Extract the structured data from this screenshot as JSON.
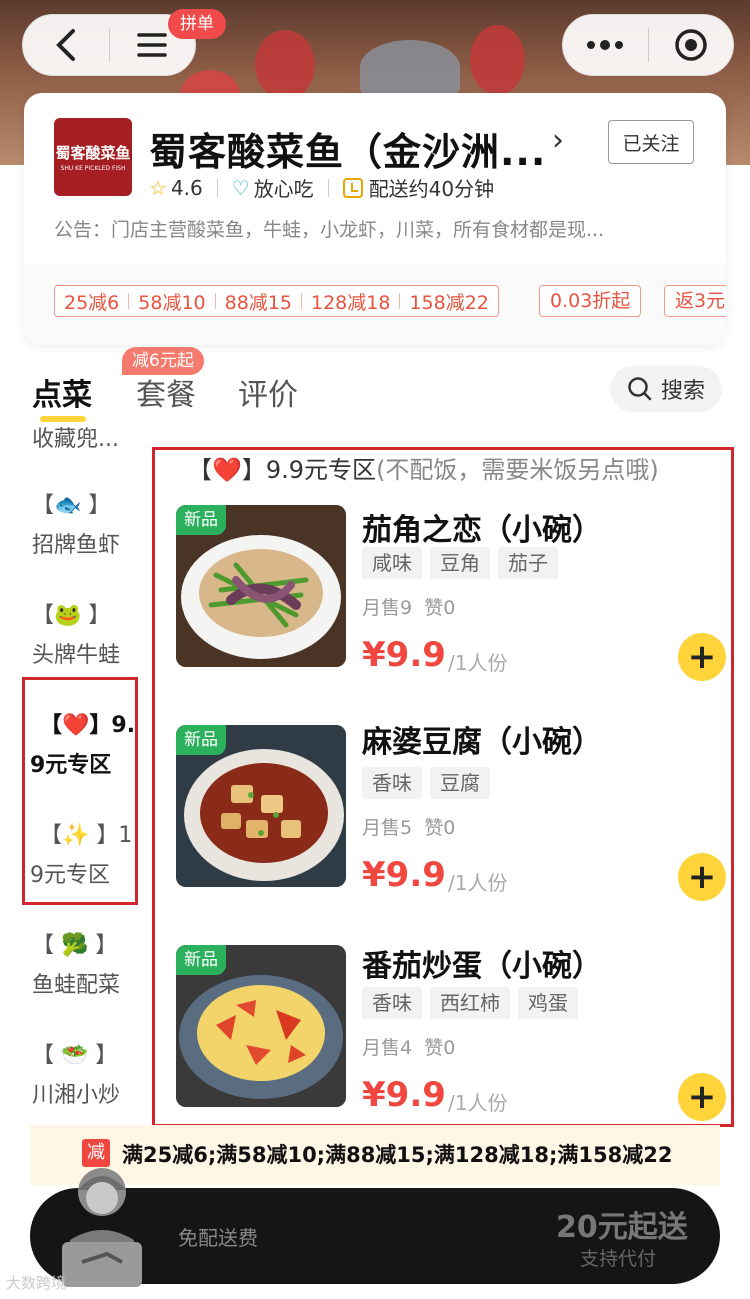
{
  "topbar": {
    "pindan_label": "拼单"
  },
  "shop": {
    "name": "蜀客酸菜鱼（金沙洲...",
    "logo_text": "蜀客酸菜鱼",
    "logo_sub": "SHU KE PICKLED FISH",
    "follow_label": "已关注",
    "rating": "4.6",
    "safe_label": "放心吃",
    "delivery_label": "配送约40分钟",
    "notice": "公告：门店主营酸菜鱼，牛蛙，小龙虾，川菜，所有食材都是现..."
  },
  "coupons": {
    "tiers": [
      "25减6",
      "58减10",
      "88减15",
      "128减18",
      "158减22"
    ],
    "discount": "0.03折起",
    "cashback": "返3元"
  },
  "tabs": {
    "items": [
      "点菜",
      "套餐",
      "评价"
    ],
    "badge": "减6元起",
    "search_label": "搜索"
  },
  "sidebar": {
    "cats": [
      {
        "emoji": "",
        "label": "收藏兜..."
      },
      {
        "emoji": "【🐟 】",
        "label": "招牌鱼虾"
      },
      {
        "emoji": "【🐸 】",
        "label": "头牌牛蛙"
      },
      {
        "emoji": "【❤️】9.",
        "label": "9元专区"
      },
      {
        "emoji": "【✨ 】1",
        "label": "9元专区"
      },
      {
        "emoji": "【 🥦 】",
        "label": "鱼蛙配菜"
      },
      {
        "emoji": "【 🥗 】",
        "label": "川湘小炒"
      }
    ]
  },
  "section": {
    "title": "【❤️】9.9元专区",
    "subtitle": "(不配饭，需要米饭另点哦)"
  },
  "items": [
    {
      "tag": "新品",
      "name": "茄角之恋（小碗）",
      "tags": [
        "咸味",
        "豆角",
        "茄子"
      ],
      "sales": "月售9",
      "likes": "赞0",
      "price": "¥9.9",
      "unit": "/1人份"
    },
    {
      "tag": "新品",
      "name": "麻婆豆腐（小碗）",
      "tags": [
        "香味",
        "豆腐"
      ],
      "sales": "月售5",
      "likes": "赞0",
      "price": "¥9.9",
      "unit": "/1人份"
    },
    {
      "tag": "新品",
      "name": "番茄炒蛋（小碗）",
      "tags": [
        "香味",
        "西红柿",
        "鸡蛋"
      ],
      "sales": "月售4",
      "likes": "赞0",
      "price": "¥9.9",
      "unit": "/1人份"
    }
  ],
  "discount_bar": {
    "icon_label": "减",
    "text": "满25减6;满58减10;满88减15;满128减18;满158减22"
  },
  "cart": {
    "free_delivery": "免配送费",
    "min_order": "20元起送",
    "pay_for_others": "支持代付"
  },
  "watermark": "大数跨境",
  "colors": {
    "accent_yellow": "#ffd43b",
    "price_red": "#f0473e",
    "highlight_red": "#d0262c",
    "new_green": "#2bb15c"
  }
}
